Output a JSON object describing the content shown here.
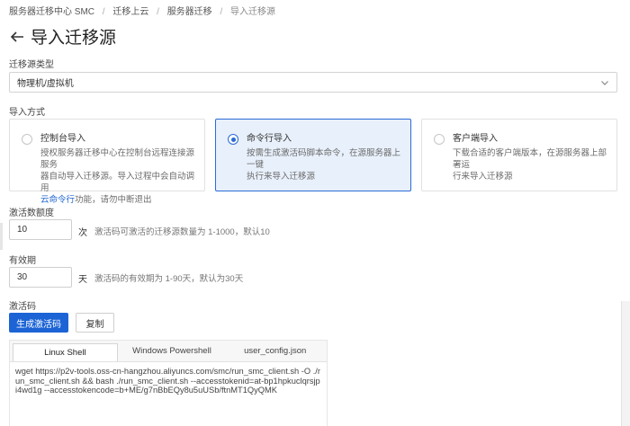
{
  "breadcrumb": {
    "items": [
      "服务器迁移中心 SMC",
      "迁移上云",
      "服务器迁移"
    ],
    "current": "导入迁移源",
    "separator": "/"
  },
  "page": {
    "title": "导入迁移源"
  },
  "source_type": {
    "label": "迁移源类型",
    "selected": "物理机/虚拟机"
  },
  "import_method": {
    "label": "导入方式",
    "options": [
      {
        "title": "控制台导入",
        "desc_line1": "授权服务器迁移中心在控制台远程连接源服务",
        "desc_line2": "器自动导入迁移源。导入过程中会自动调用",
        "desc_link": "云命令行",
        "desc_line3": "功能，请勿中断退出",
        "selected": false
      },
      {
        "title": "命令行导入",
        "desc_line1": "按需生成激活码脚本命令，在源服务器上一键",
        "desc_line2": "执行来导入迁移源",
        "selected": true
      },
      {
        "title": "客户端导入",
        "desc_line1": "下载合适的客户端版本，在源服务器上部署运",
        "desc_line2": "行来导入迁移源",
        "selected": false
      }
    ]
  },
  "quota": {
    "label": "激活数额度",
    "value": "10",
    "unit": "次",
    "hint": "激活码可激活的迁移源数量为 1-1000，默认10"
  },
  "validity": {
    "label": "有效期",
    "value": "30",
    "unit": "天",
    "hint": "激活码的有效期为 1-90天，默认为30天"
  },
  "activation": {
    "label": "激活码",
    "generate_button": "生成激活码",
    "copy_button": "复制",
    "tabs": [
      "Linux Shell",
      "Windows Powershell",
      "user_config.json"
    ],
    "active_tab": "Linux Shell",
    "command": "wget https://p2v-tools.oss-cn-hangzhou.aliyuncs.com/smc/run_smc_client.sh -O ./run_smc_client.sh && bash ./run_smc_client.sh --accesstokenid=at-bp1hpkuclqrsjpi4wd1g --accesstokencode=b+ME/g7nBbEQy8u5uUSb/ftnMT1QyQMK"
  },
  "colors": {
    "primary": "#1c64d6",
    "selected_card_bg": "#e8f0fb",
    "link": "#1d63d1"
  }
}
